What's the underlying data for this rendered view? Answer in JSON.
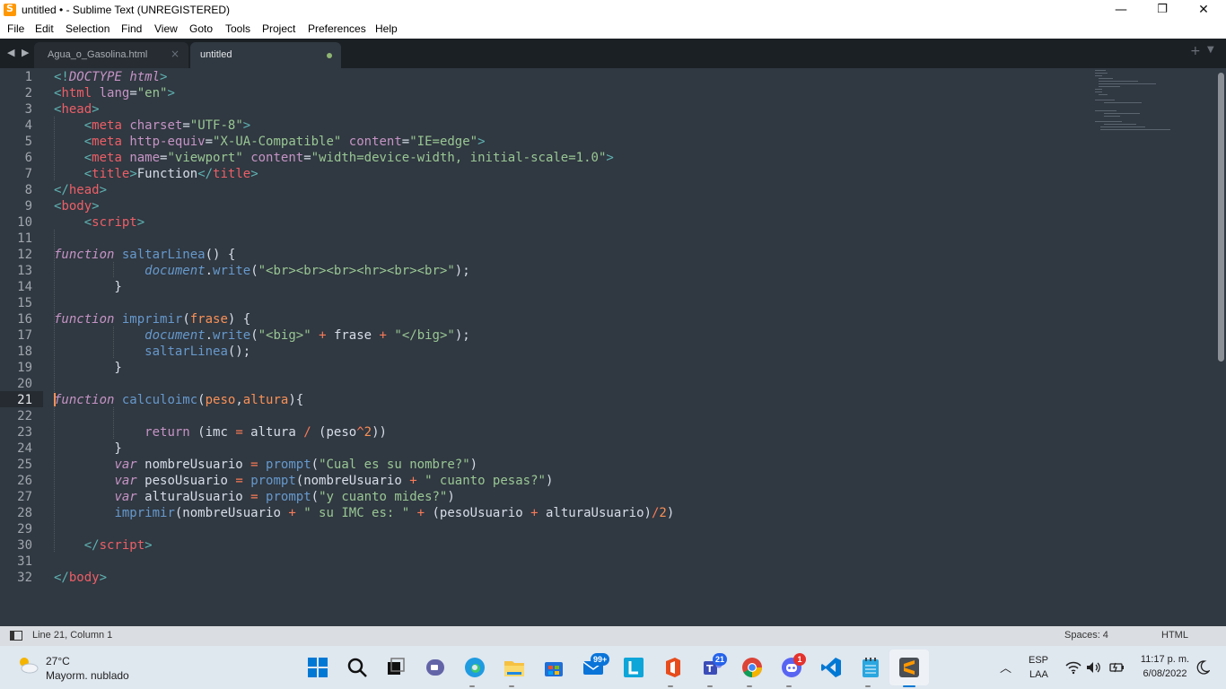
{
  "window": {
    "title": "untitled • - Sublime Text (UNREGISTERED)",
    "minimize": "—",
    "maximize": "❐",
    "close": "✕"
  },
  "menu": [
    "File",
    "Edit",
    "Selection",
    "Find",
    "View",
    "Goto",
    "Tools",
    "Project",
    "Preferences",
    "Help"
  ],
  "tabs": [
    {
      "label": "Agua_o_Gasolina.html",
      "active": false,
      "close": "×"
    },
    {
      "label": "untitled",
      "active": true,
      "modified": true
    }
  ],
  "tabbar": {
    "nav": "◀ ▶",
    "new_tab": "+",
    "tab_menu": "▼"
  },
  "editor": {
    "line_numbers": [
      "1",
      "2",
      "3",
      "4",
      "5",
      "6",
      "7",
      "8",
      "9",
      "10",
      "11",
      "12",
      "13",
      "14",
      "15",
      "16",
      "17",
      "18",
      "19",
      "20",
      "21",
      "22",
      "23",
      "24",
      "25",
      "26",
      "27",
      "28",
      "29",
      "30",
      "31",
      "32"
    ],
    "active_line": 21
  },
  "status": {
    "position": "Line 21, Column 1",
    "indent": "Spaces: 4",
    "syntax": "HTML"
  },
  "taskbar": {
    "weather_temp": "27°C",
    "weather_desc": "Mayorm. nublado",
    "badge_mail": "99+",
    "badge_teams": "21",
    "badge_discord": "1",
    "lang_1": "ESP",
    "lang_2": "LAA",
    "time": "11:17 p. m.",
    "date": "6/08/2022"
  },
  "colors": {
    "accent": "#ff9800",
    "editor_bg": "#303841",
    "tab_bar": "#1b2025"
  }
}
